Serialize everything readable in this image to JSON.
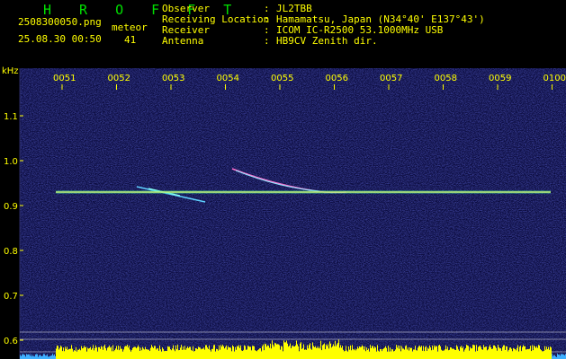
{
  "header": {
    "app_title": "H R O F F T",
    "filename": "2508300050.png",
    "datetime": "25.08.30 00:50",
    "meteor_label": "meteor",
    "meteor_count": "41"
  },
  "info": [
    {
      "label": "Observer",
      "value": "JL2TBB"
    },
    {
      "label": "Receiving Location",
      "value": "Hamamatsu, Japan (N34°40' E137°43')"
    },
    {
      "label": "Receiver",
      "value": "ICOM IC-R2500 53.1000MHz USB"
    },
    {
      "label": "Antenna",
      "value": "HB9CV Zenith dir."
    }
  ],
  "axis": {
    "y_unit": "kHz",
    "y_ticks": [
      "1.1",
      "1.0",
      "0.9",
      "0.8",
      "0.7",
      "0.6"
    ],
    "y_values": [
      1.1,
      1.0,
      0.9,
      0.8,
      0.7,
      0.6
    ],
    "x_ticks": [
      "0051",
      "0052",
      "0053",
      "0054",
      "0055",
      "0056",
      "0057",
      "0058",
      "0059",
      "0100"
    ]
  },
  "chart_data": {
    "type": "heatmap",
    "xlabel": "",
    "ylabel": "kHz",
    "ylim": [
      0.59,
      1.2
    ],
    "x_time_ticks": [
      "0051",
      "0052",
      "0053",
      "0054",
      "0055",
      "0056",
      "0057",
      "0058",
      "0059",
      "0100"
    ],
    "carrier_kHz": 0.93
  },
  "colors": {
    "background": "#0a0a3c",
    "header_text": "#ffff00",
    "title_text": "#00e000",
    "tick_text": "#ffff00",
    "carrier": "#ffff66",
    "spectrum": "#ffff00",
    "spectrum_base": "#3fb0ff"
  }
}
